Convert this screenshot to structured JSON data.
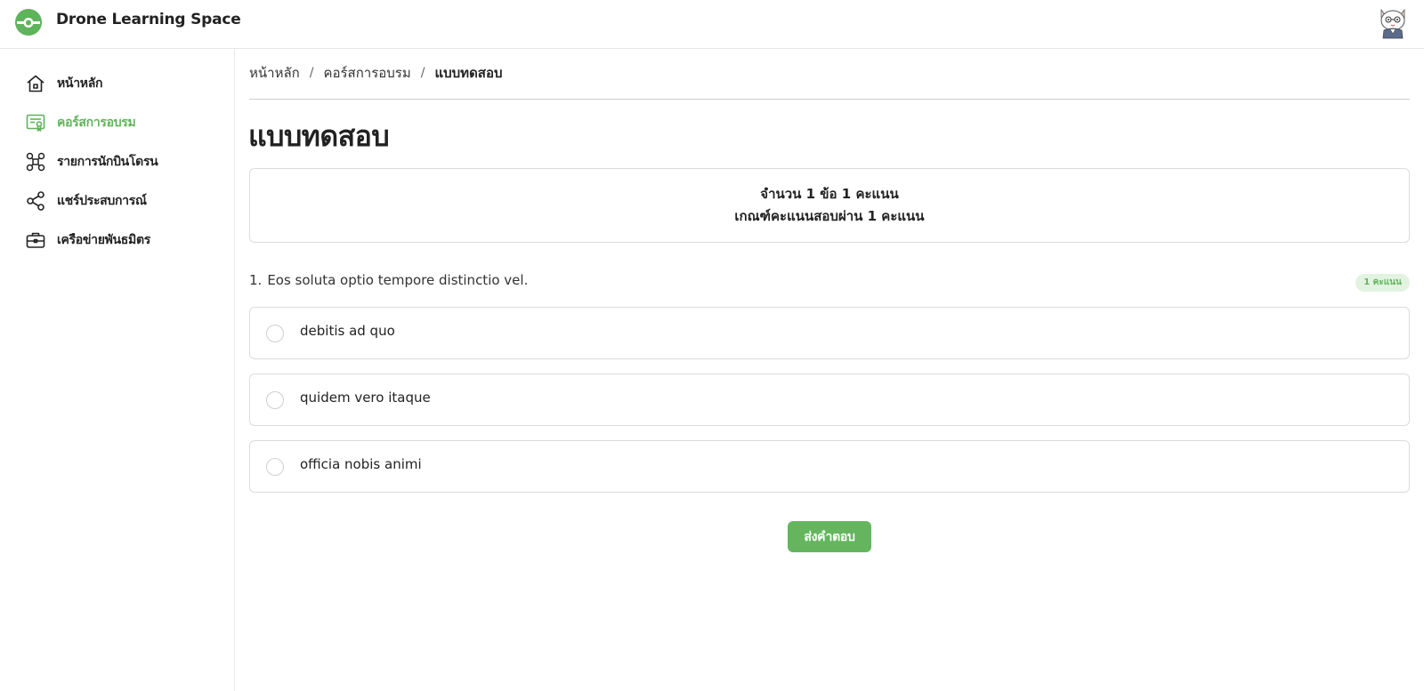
{
  "header": {
    "app_title": "Drone Learning Space",
    "logo_icon": "drone-lens-logo",
    "avatar_icon": "cat-avatar",
    "brand_color": "#5fb35a"
  },
  "sidebar": {
    "items": [
      {
        "label": "หน้าหลัก",
        "icon": "home-icon",
        "active": false
      },
      {
        "label": "คอร์สการอบรม",
        "icon": "certificate-icon",
        "active": true
      },
      {
        "label": "รายการนักบินโดรน",
        "icon": "drone-icon",
        "active": false
      },
      {
        "label": "แชร์ประสบการณ์",
        "icon": "share-icon",
        "active": false
      },
      {
        "label": "เครือข่ายพันธมิตร",
        "icon": "briefcase-icon",
        "active": false
      }
    ]
  },
  "breadcrumb": {
    "items": [
      "หน้าหลัก",
      "คอร์สการอบรม",
      "แบบทดสอบ"
    ],
    "separator": "/"
  },
  "page": {
    "title": "แบบทดสอบ"
  },
  "summary": {
    "line1": "จำนวน 1 ข้อ 1 คะแนน",
    "line2": "เกณฑ์คะแนนสอบผ่าน 1 คะแนน"
  },
  "question": {
    "number": "1.",
    "text": "Eos soluta optio tempore distinctio vel.",
    "score_badge": "1 คะแนน",
    "options": [
      "debitis ad quo",
      "quidem vero itaque",
      "officia nobis animi"
    ]
  },
  "actions": {
    "submit_label": "ส่งคำตอบ",
    "submit_color": "#64b55e"
  }
}
